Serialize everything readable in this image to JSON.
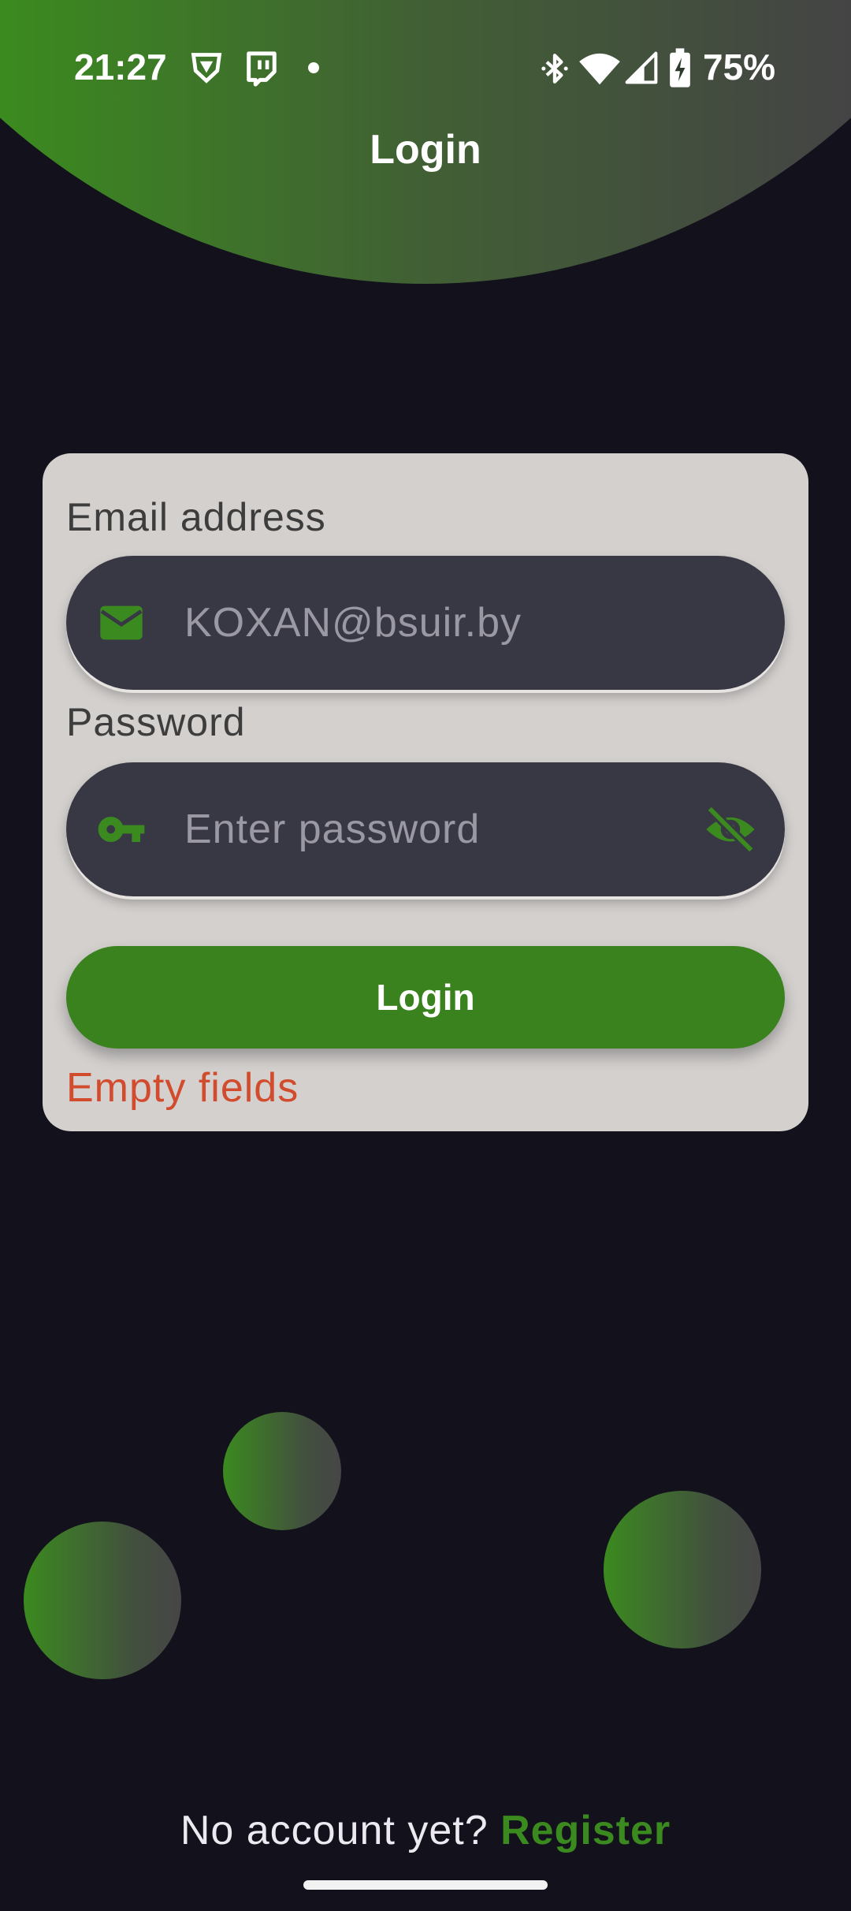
{
  "status_bar": {
    "time": "21:27",
    "battery_percent": "75%",
    "icons": [
      "vpn-shield-icon",
      "twitch-icon",
      "notification-dot-icon",
      "bluetooth-icon",
      "wifi-icon",
      "cell-signal-icon",
      "battery-charging-icon"
    ]
  },
  "header": {
    "title": "Login"
  },
  "form": {
    "email_label": "Email address",
    "email_value": "KOXAN@bsuir.by",
    "email_icon": "email-icon",
    "password_label": "Password",
    "password_placeholder": "Enter password",
    "password_icon": "key-icon",
    "visibility_icon": "visibility-off-icon",
    "login_button": "Login",
    "error_message": "Empty fields"
  },
  "footer": {
    "no_account_text": "No account yet?",
    "register_link": "Register"
  },
  "colors": {
    "background": "#13121c",
    "accent_green": "#3a821e",
    "card": "#d3d0ce",
    "field": "#383744",
    "error": "#d24b2c"
  }
}
